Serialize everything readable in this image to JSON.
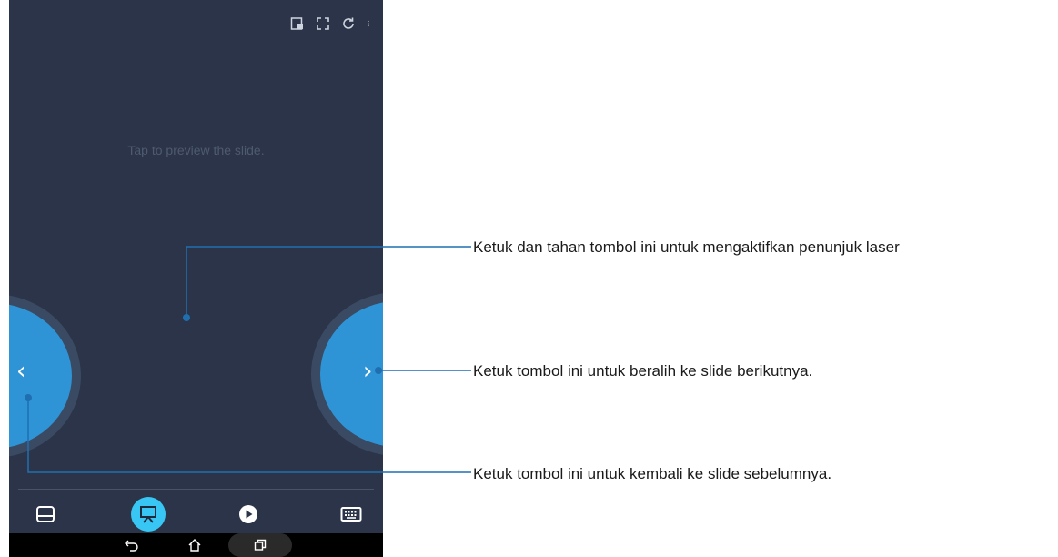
{
  "screen": {
    "hint": "Tap to preview the slide.",
    "top_icons": [
      "pip-icon",
      "fullscreen-icon",
      "refresh-icon",
      "more-vertical-icon"
    ]
  },
  "nav": {
    "prev_glyph": "‹",
    "next_glyph": "›"
  },
  "bottom_tabs": [
    {
      "name": "touchpad",
      "icon": "touchpad-icon",
      "active": false
    },
    {
      "name": "presentation",
      "icon": "presentation-icon",
      "active": true
    },
    {
      "name": "play",
      "icon": "play-icon",
      "active": false
    },
    {
      "name": "keyboard",
      "icon": "keyboard-icon",
      "active": false
    }
  ],
  "android_nav": [
    "back-icon",
    "home-icon",
    "recent-apps-icon"
  ],
  "callouts": {
    "laser": "Ketuk dan tahan tombol ini untuk mengaktifkan penunjuk laser",
    "next": "Ketuk tombol ini untuk beralih ke slide berikutnya.",
    "prev": "Ketuk tombol ini untuk kembali ke slide sebelumnya."
  },
  "colors": {
    "background": "#2b3448",
    "nav_button": "#2f94d6",
    "active_tab": "#38c6f4",
    "callout_line": "#1f6fb0"
  }
}
